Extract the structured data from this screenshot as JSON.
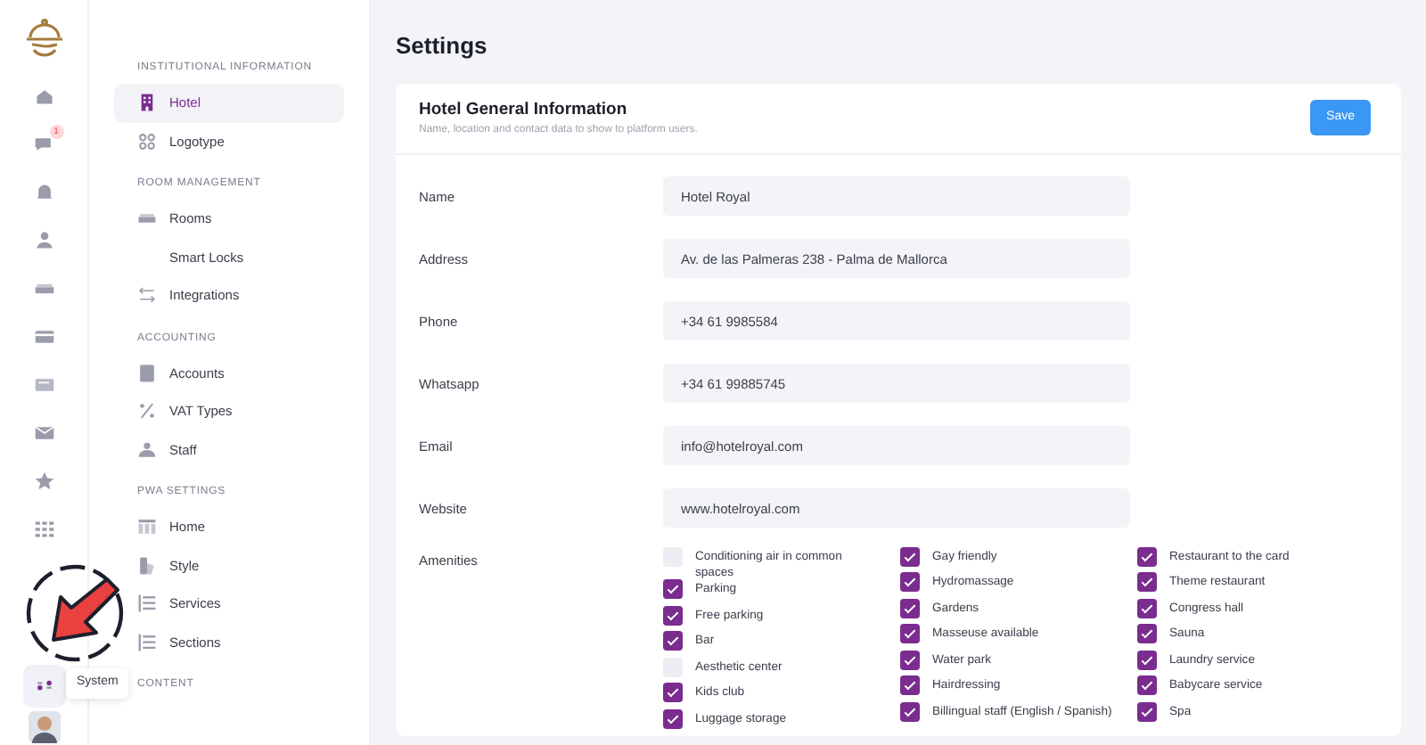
{
  "rail": {
    "items": [
      {
        "kind": "home",
        "selected": false
      },
      {
        "kind": "chat",
        "selected": false,
        "badge": "1"
      },
      {
        "kind": "bell",
        "selected": false
      },
      {
        "kind": "person",
        "selected": false
      },
      {
        "kind": "bed",
        "selected": false
      },
      {
        "kind": "card",
        "selected": false
      },
      {
        "kind": "message",
        "selected": false
      },
      {
        "kind": "mail",
        "selected": false
      },
      {
        "kind": "star",
        "selected": false
      },
      {
        "kind": "grid",
        "selected": false
      }
    ],
    "system": {
      "kind": "system",
      "selected": true,
      "tooltip": "System"
    }
  },
  "nav": {
    "sections": [
      {
        "title": "INSTITUTIONAL INFORMATION",
        "items": [
          {
            "label": "Hotel",
            "kind": "building",
            "selected": true
          },
          {
            "label": "Logotype",
            "kind": "logo",
            "selected": false
          }
        ]
      },
      {
        "title": "ROOM MANAGEMENT",
        "items": [
          {
            "label": "Rooms",
            "kind": "bed",
            "selected": false
          },
          {
            "label": "Smart Locks",
            "kind": "plain",
            "selected": false
          },
          {
            "label": "Integrations",
            "kind": "arrows",
            "selected": false
          }
        ]
      },
      {
        "title": "ACCOUNTING",
        "items": [
          {
            "label": "Accounts",
            "kind": "book",
            "selected": false
          },
          {
            "label": "VAT Types",
            "kind": "percent",
            "selected": false
          },
          {
            "label": "Staff",
            "kind": "people",
            "selected": false
          }
        ]
      },
      {
        "title": "PWA SETTINGS",
        "items": [
          {
            "label": "Home",
            "kind": "layout",
            "selected": false
          },
          {
            "label": "Style",
            "kind": "palette",
            "selected": false
          },
          {
            "label": "Services",
            "kind": "list",
            "selected": false
          },
          {
            "label": "Sections",
            "kind": "list",
            "selected": false
          }
        ]
      },
      {
        "title": "CONTENT"
      }
    ]
  },
  "page_title": "Settings",
  "card": {
    "title": "Hotel General Information",
    "subtitle": "Name, location and contact data to show to platform users.",
    "save_button": "Save",
    "fields": [
      {
        "label": "Name",
        "value": "Hotel Royal"
      },
      {
        "label": "Address",
        "value": "Av. de las Palmeras 238 - Palma de Mallorca"
      },
      {
        "label": "Phone",
        "value": "+34 61 9985584"
      },
      {
        "label": "Whatsapp",
        "value": "+34 61 99885745"
      },
      {
        "label": "Email",
        "value": "info@hotelroyal.com"
      },
      {
        "label": "Website",
        "value": "www.hotelroyal.com"
      }
    ],
    "amenities": {
      "label": "Amenities",
      "columns": [
        [
          {
            "label": "Conditioning air in common spaces",
            "checked": false
          },
          {
            "label": "Parking",
            "checked": true
          },
          {
            "label": "Free parking",
            "checked": true
          },
          {
            "label": "Bar",
            "checked": true
          },
          {
            "label": "Aesthetic center",
            "checked": false
          },
          {
            "label": "Kids club",
            "checked": true
          },
          {
            "label": "Luggage storage",
            "checked": true
          }
        ],
        [
          {
            "label": "Gay friendly",
            "checked": true
          },
          {
            "label": "Hydromassage",
            "checked": true
          },
          {
            "label": "Gardens",
            "checked": true
          },
          {
            "label": "Masseuse available",
            "checked": true
          },
          {
            "label": "Water park",
            "checked": true
          },
          {
            "label": "Hairdressing",
            "checked": true
          },
          {
            "label": "Billingual staff (English / Spanish)",
            "checked": true
          }
        ],
        [
          {
            "label": "Restaurant to the card",
            "checked": true
          },
          {
            "label": "Theme restaurant",
            "checked": true
          },
          {
            "label": "Congress hall",
            "checked": true
          },
          {
            "label": "Sauna",
            "checked": true
          },
          {
            "label": "Laundry service",
            "checked": true
          },
          {
            "label": "Babycare service",
            "checked": true
          },
          {
            "label": "Spa",
            "checked": true
          }
        ]
      ]
    }
  }
}
